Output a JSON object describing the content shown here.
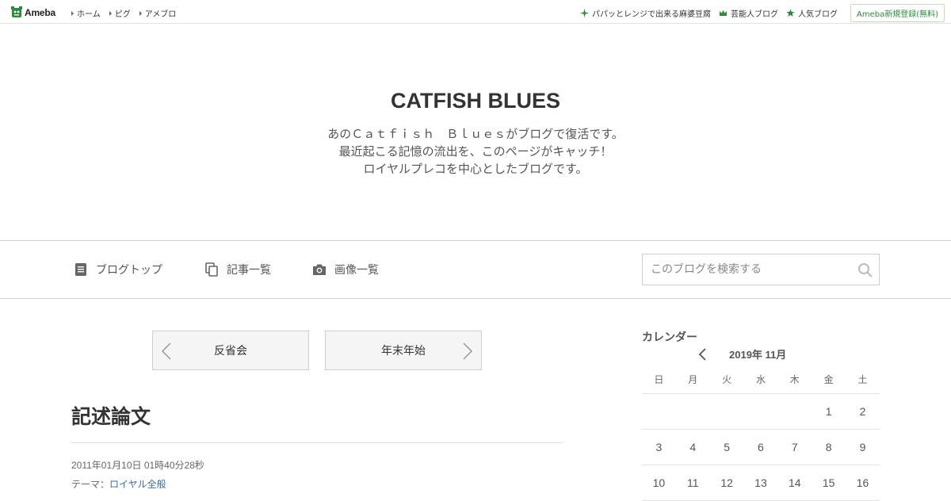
{
  "topbar": {
    "logo_text": "Ameba",
    "nav": [
      "ホーム",
      "ピグ",
      "アメブロ"
    ],
    "links": [
      {
        "label": "パパッとレンジで出来る麻婆豆腐",
        "icon": "sparkle-icon"
      },
      {
        "label": "芸能人ブログ",
        "icon": "crown-icon"
      },
      {
        "label": "人気ブログ",
        "icon": "star-icon"
      }
    ],
    "register_label": "Ameba新規登録(無料)"
  },
  "blog": {
    "title": "CATFISH BLUES",
    "description": [
      "あのＣａｔｆｉｓｈ　Ｂｌｕｅｓがブログで復活です。",
      "最近起こる記憶の流出を、このページがキャッチ！",
      "ロイヤルプレコを中心としたブログです。"
    ]
  },
  "nav": {
    "blog_top": "ブログトップ",
    "articles": "記事一覧",
    "images": "画像一覧",
    "search_placeholder": "このブログを検索する"
  },
  "pager": {
    "prev": "反省会",
    "next": "年末年始"
  },
  "article": {
    "title": "記述論文",
    "date": "2011年01月10日 01時40分28秒",
    "theme_label": "テーマ：",
    "theme_value": "ロイヤル全般"
  },
  "calendar": {
    "heading": "カレンダー",
    "month": "2019年 11月",
    "weekdays": [
      "日",
      "月",
      "火",
      "水",
      "木",
      "金",
      "土"
    ],
    "weeks": [
      [
        "",
        "",
        "",
        "",
        "",
        "1",
        "2"
      ],
      [
        "3",
        "4",
        "5",
        "6",
        "7",
        "8",
        "9"
      ],
      [
        "10",
        "11",
        "12",
        "13",
        "14",
        "15",
        "16"
      ]
    ]
  },
  "colors": {
    "accent_green": "#2d8c3c",
    "link_blue": "#3a6ea5"
  }
}
